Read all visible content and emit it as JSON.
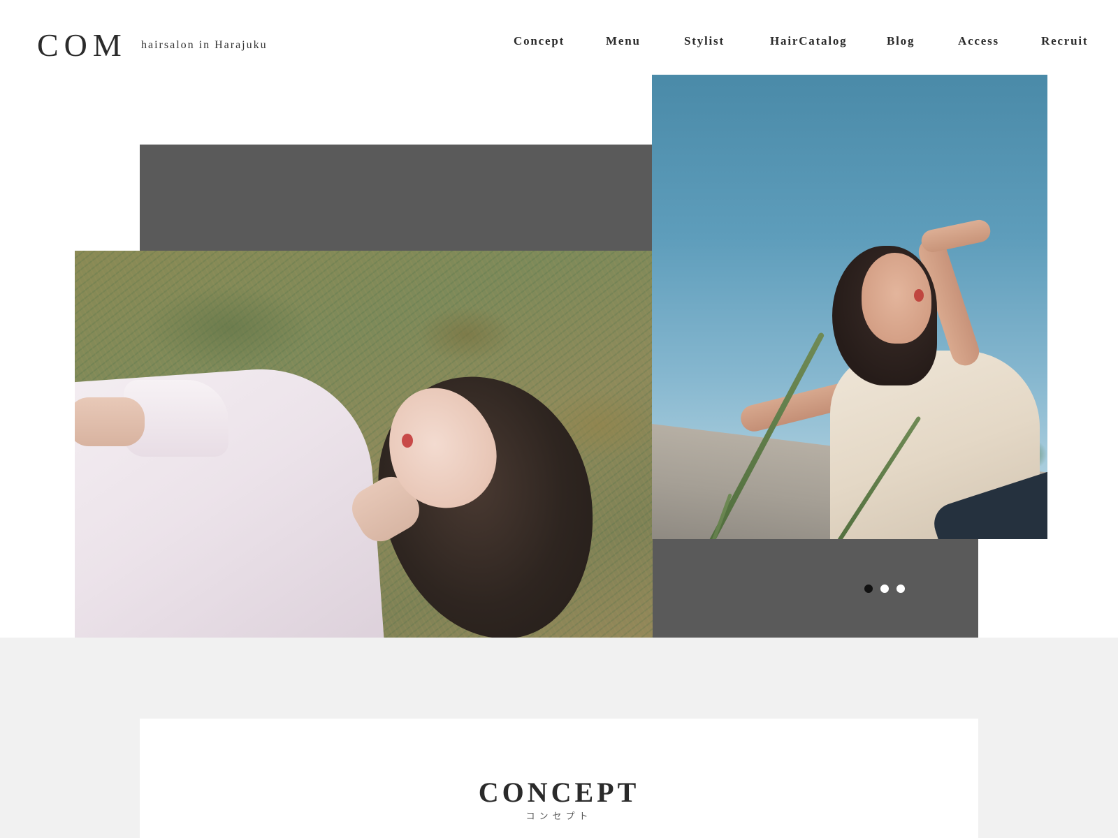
{
  "header": {
    "logo": "COM",
    "tagline": "hairsalon in Harajuku"
  },
  "nav": {
    "items": [
      {
        "label": "Concept"
      },
      {
        "label": "Menu"
      },
      {
        "label": "Stylist"
      },
      {
        "label": "HairCatalog"
      },
      {
        "label": "Blog"
      },
      {
        "label": "Access"
      },
      {
        "label": "Recruit"
      }
    ]
  },
  "hero": {
    "photos": [
      {
        "subject": "woman lying on grass in white shirt"
      },
      {
        "subject": "woman raising arm against blue sky"
      }
    ],
    "slider": {
      "total": 3,
      "active_index": 0
    }
  },
  "concept": {
    "title": "CONCEPT",
    "subtitle": "コンセプト"
  },
  "colors": {
    "accent_gray": "#5a5a5a",
    "background_band": "#f1f1f1",
    "text": "#2a2a2a"
  }
}
